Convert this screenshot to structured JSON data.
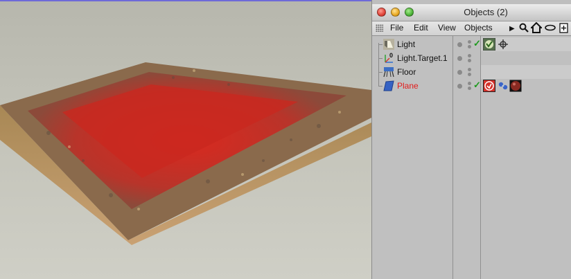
{
  "panel": {
    "title": "Objects (2)",
    "menu": [
      "File",
      "Edit",
      "View",
      "Objects"
    ]
  },
  "toolbar_icons": [
    "play-arrow-icon",
    "search-icon",
    "home-icon",
    "eye-icon",
    "new-window-icon"
  ],
  "objects": [
    {
      "name": "Light",
      "icon": "light-icon",
      "enabled": true,
      "tags": [
        "target-tag-icon",
        "target-crosshair-icon"
      ],
      "selected": false
    },
    {
      "name": "Light.Target.1",
      "icon": "null-target-icon",
      "enabled": false,
      "tags": [],
      "selected": false
    },
    {
      "name": "Floor",
      "icon": "floor-icon",
      "enabled": false,
      "tags": [],
      "selected": false
    },
    {
      "name": "Plane",
      "icon": "plane-icon",
      "enabled": true,
      "tags": [
        "hair-tag-icon",
        "texture-link-icon",
        "material-tag-icon"
      ],
      "selected": true
    }
  ],
  "colors": {
    "selected_text": "#e21b1b",
    "check": "#1d9a1d",
    "carpet_red": "#c2241d"
  }
}
